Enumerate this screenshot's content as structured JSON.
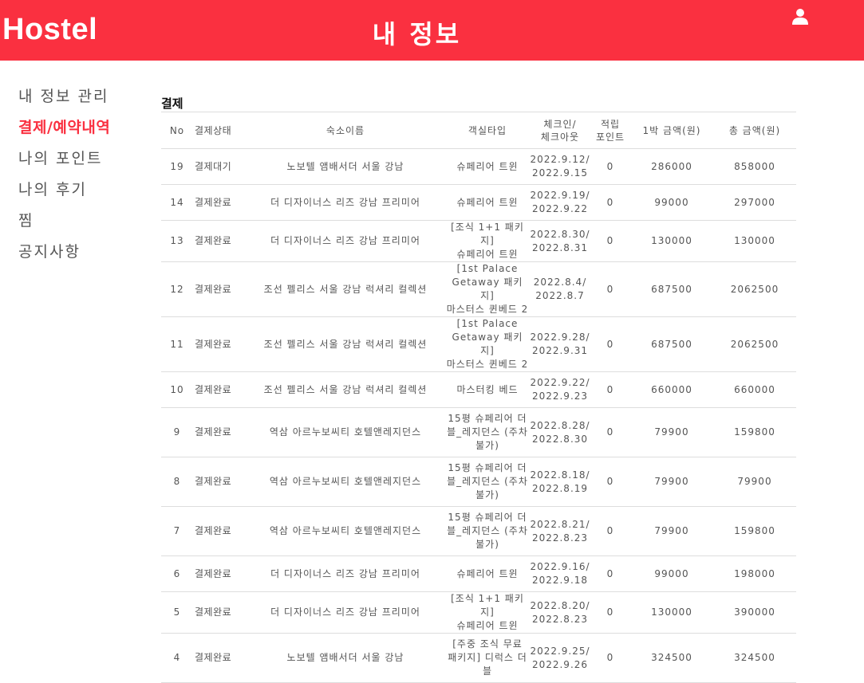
{
  "header": {
    "brand": "Hostel",
    "title": "내 정보",
    "user_icon": "user-icon"
  },
  "colors": {
    "accent": "#fa3040",
    "text": "#555555",
    "border": "#dddddd"
  },
  "sidebar": {
    "items": [
      {
        "label": "내 정보 관리",
        "active": false
      },
      {
        "label": "결제/예약내역",
        "active": true
      },
      {
        "label": "나의 포인트",
        "active": false
      },
      {
        "label": "나의 후기",
        "active": false
      },
      {
        "label": "찜",
        "active": false
      },
      {
        "label": "공지사항",
        "active": false
      }
    ]
  },
  "main": {
    "section_title": "결제",
    "columns": [
      "No",
      "결제상태",
      "숙소이름",
      "객실타입",
      "체크인/\n체크아웃",
      "적립\n포인트",
      "1박 금액(원)",
      "총 금액(원)"
    ],
    "rows": [
      {
        "no": "19",
        "status": "결제대기",
        "hotel": "노보텔 앰배서더 서울 강남",
        "room": "슈페리어 트윈",
        "dates": "2022.9.12/\n2022.9.15",
        "points": "0",
        "nightly": "286000",
        "total": "858000"
      },
      {
        "no": "14",
        "status": "결제완료",
        "hotel": "더 디자이너스 리즈 강남 프리미어",
        "room": "슈페리어 트윈",
        "dates": "2022.9.19/\n2022.9.22",
        "points": "0",
        "nightly": "99000",
        "total": "297000"
      },
      {
        "no": "13",
        "status": "결제완료",
        "hotel": "더 디자이너스 리즈 강남 프리미어",
        "room": "[조식 1+1 패키지]\n슈페리어 트윈",
        "dates": "2022.8.30/\n2022.8.31",
        "points": "0",
        "nightly": "130000",
        "total": "130000"
      },
      {
        "no": "12",
        "status": "결제완료",
        "hotel": "조선 펠리스 서울 강남 럭셔리 컬렉션",
        "room": "[1st Palace\nGetaway 패키지]\n마스터스 퀸베드 2",
        "dates": "2022.8.4/\n2022.8.7",
        "points": "0",
        "nightly": "687500",
        "total": "2062500"
      },
      {
        "no": "11",
        "status": "결제완료",
        "hotel": "조선 펠리스 서울 강남 럭셔리 컬렉션",
        "room": "[1st Palace\nGetaway 패키지]\n마스터스 퀸베드 2",
        "dates": "2022.9.28/\n2022.9.31",
        "points": "0",
        "nightly": "687500",
        "total": "2062500"
      },
      {
        "no": "10",
        "status": "결제완료",
        "hotel": "조선 펠리스 서울 강남 럭셔리 컬렉션",
        "room": "마스터킹 베드",
        "dates": "2022.9.22/\n2022.9.23",
        "points": "0",
        "nightly": "660000",
        "total": "660000"
      },
      {
        "no": "9",
        "status": "결제완료",
        "hotel": "역삼 아르누보씨티 호텔앤레지던스",
        "room": "15평 슈페리어 더\n블_레지던스 (주차\n불가)",
        "dates": "2022.8.28/\n2022.8.30",
        "points": "0",
        "nightly": "79900",
        "total": "159800"
      },
      {
        "no": "8",
        "status": "결제완료",
        "hotel": "역삼 아르누보씨티 호텔앤레지던스",
        "room": "15평 슈페리어 더\n블_레지던스 (주차\n불가)",
        "dates": "2022.8.18/\n2022.8.19",
        "points": "0",
        "nightly": "79900",
        "total": "79900"
      },
      {
        "no": "7",
        "status": "결제완료",
        "hotel": "역삼 아르누보씨티 호텔앤레지던스",
        "room": "15평 슈페리어 더\n블_레지던스 (주차\n불가)",
        "dates": "2022.8.21/\n2022.8.23",
        "points": "0",
        "nightly": "79900",
        "total": "159800"
      },
      {
        "no": "6",
        "status": "결제완료",
        "hotel": "더 디자이너스 리즈 강남 프리미어",
        "room": "슈페리어 트윈",
        "dates": "2022.9.16/\n2022.9.18",
        "points": "0",
        "nightly": "99000",
        "total": "198000"
      },
      {
        "no": "5",
        "status": "결제완료",
        "hotel": "더 디자이너스 리즈 강남 프리미어",
        "room": "[조식 1+1 패키지]\n슈페리어 트윈",
        "dates": "2022.8.20/\n2022.8.23",
        "points": "0",
        "nightly": "130000",
        "total": "390000"
      },
      {
        "no": "4",
        "status": "결제완료",
        "hotel": "노보텔 앰배서더 서울 강남",
        "room": "[주중 조식 무료\n패키지] 디럭스 더\n블",
        "dates": "2022.9.25/\n2022.9.26",
        "points": "0",
        "nightly": "324500",
        "total": "324500"
      }
    ]
  }
}
